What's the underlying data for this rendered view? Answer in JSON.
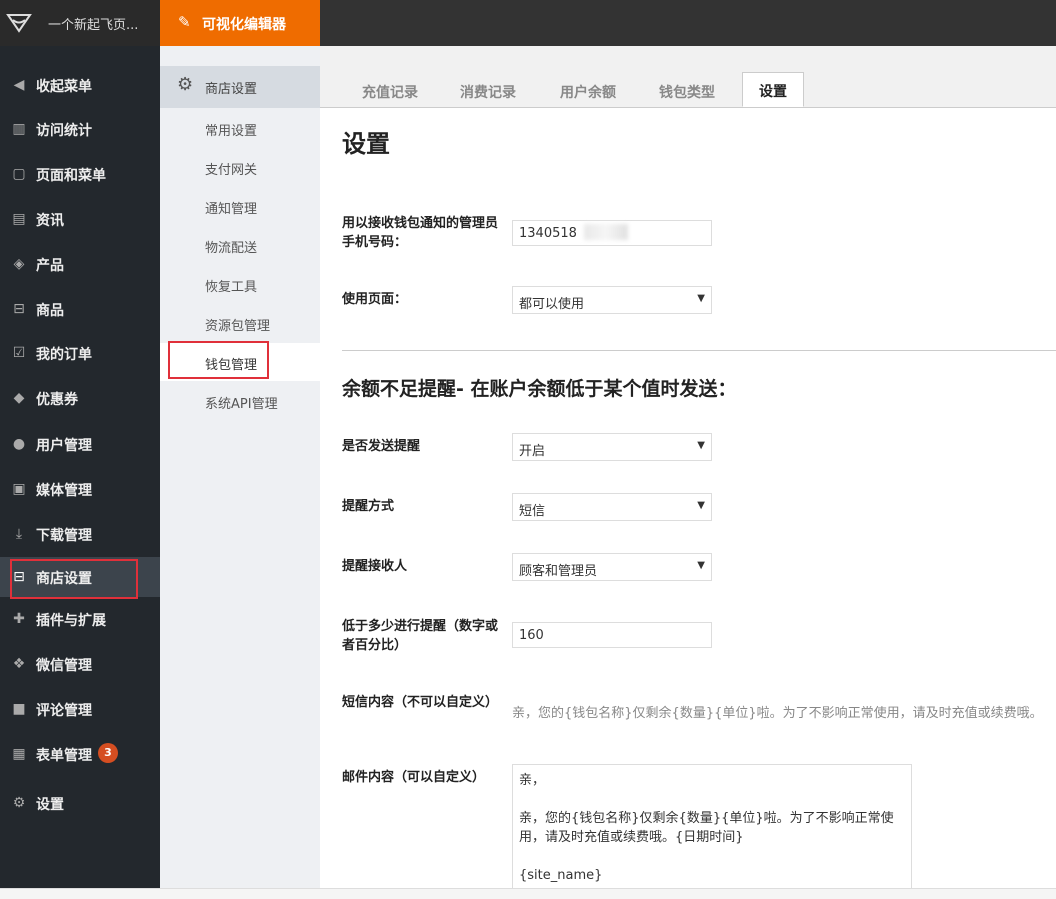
{
  "topbar": {
    "site_name": "一个新起飞页...",
    "visual_editor": "可视化编辑器"
  },
  "sidebar": {
    "items": [
      {
        "label": "收起菜单",
        "icon": "collapse-icon"
      },
      {
        "label": "访问统计",
        "icon": "bar-chart-icon"
      },
      {
        "label": "页面和菜单",
        "icon": "page-icon"
      },
      {
        "label": "资讯",
        "icon": "document-icon"
      },
      {
        "label": "产品",
        "icon": "cubes-icon"
      },
      {
        "label": "商品",
        "icon": "cart-icon"
      },
      {
        "label": "我的订单",
        "icon": "checkbox-icon"
      },
      {
        "label": "优惠券",
        "icon": "tag-icon"
      },
      {
        "label": "用户管理",
        "icon": "user-icon"
      },
      {
        "label": "媒体管理",
        "icon": "media-icon"
      },
      {
        "label": "下载管理",
        "icon": "download-icon"
      },
      {
        "label": "商店设置",
        "icon": "cart-icon"
      },
      {
        "label": "插件与扩展",
        "icon": "puzzle-icon"
      },
      {
        "label": "微信管理",
        "icon": "wechat-icon"
      },
      {
        "label": "评论管理",
        "icon": "comment-icon"
      },
      {
        "label": "表单管理",
        "icon": "table-icon",
        "badge": "3"
      },
      {
        "label": "设置",
        "icon": "gear-icon"
      }
    ]
  },
  "subnav": {
    "header": "商店设置",
    "items": [
      "常用设置",
      "支付网关",
      "通知管理",
      "物流配送",
      "恢复工具",
      "资源包管理",
      "钱包管理",
      "系统API管理"
    ]
  },
  "tabs": [
    "充值记录",
    "消费记录",
    "用户余额",
    "钱包类型",
    "设置"
  ],
  "page_title": "设置",
  "form": {
    "phone_label": "用以接收钱包通知的管理员手机号码：",
    "phone_value": "1340518",
    "usage_label": "使用页面：",
    "usage_value": "都可以使用",
    "section_title": "余额不足提醒- 在账户余额低于某个值时发送：",
    "send_label": "是否发送提醒",
    "send_value": "开启",
    "method_label": "提醒方式",
    "method_value": "短信",
    "receiver_label": "提醒接收人",
    "receiver_value": "顾客和管理员",
    "threshold_label": "低于多少进行提醒（数字或者百分比）",
    "threshold_value": "160",
    "sms_label": "短信内容（不可以自定义）",
    "sms_text": "亲，您的{钱包名称}仅剩余{数量}{单位}啦。为了不影响正常使用，请及时充值或续费哦。",
    "email_label": "邮件内容（可以自定义）",
    "email_lines": [
      "亲，",
      "",
      "亲，您的{钱包名称}仅剩余{数量}{单位}啦。为了不影响正常使用，请及时充值或续费哦。{日期时间}",
      "",
      "{site_name}"
    ]
  },
  "colors": {
    "accent": "#ef6c00",
    "sidebar_bg": "#23282d",
    "highlight": "#e0303a"
  }
}
